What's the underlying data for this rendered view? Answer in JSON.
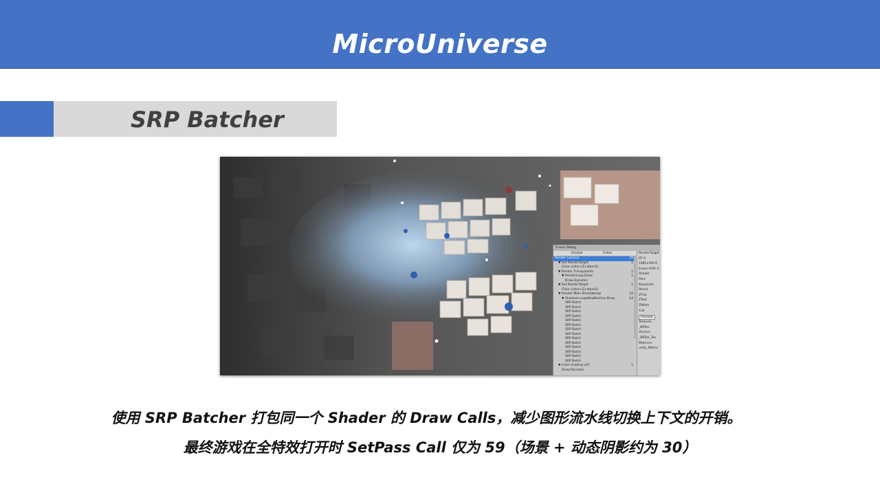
{
  "header": {
    "title": "MicroUniverse"
  },
  "section": {
    "title": "SRP Batcher"
  },
  "frame_debugger": {
    "window_title": "Frame Debug",
    "toggle_label": "Disable",
    "target_label": "Editor",
    "tree": [
      {
        "label": "Render Camera",
        "count": "59",
        "indent": 0,
        "selected": true
      },
      {
        "label": "▼ Set RenderTarget",
        "count": "1",
        "indent": 1
      },
      {
        "label": "Clear (color+Z+stencil)",
        "count": "",
        "indent": 2
      },
      {
        "label": "▼ Render Transparents",
        "count": "1",
        "indent": 1
      },
      {
        "label": "▼ RenderLoop.Draw",
        "count": "1",
        "indent": 2
      },
      {
        "label": "Draw Dynamic",
        "count": "",
        "indent": 3
      },
      {
        "label": "▼ Set RenderTarget",
        "count": "1",
        "indent": 1
      },
      {
        "label": "Clear (color+Z+stencil)",
        "count": "",
        "indent": 2
      },
      {
        "label": "▼ Render Main Shadowmap",
        "count": "14",
        "indent": 1
      },
      {
        "label": "▼ Shadows.LoopNewBatcher.Draw",
        "count": "14",
        "indent": 2
      },
      {
        "label": "SRP Batch",
        "count": "",
        "indent": 3
      },
      {
        "label": "SRP Batch",
        "count": "",
        "indent": 3
      },
      {
        "label": "SRP Batch",
        "count": "",
        "indent": 3
      },
      {
        "label": "SRP Batch",
        "count": "",
        "indent": 3
      },
      {
        "label": "SRP Batch",
        "count": "",
        "indent": 3
      },
      {
        "label": "SRP Batch",
        "count": "",
        "indent": 3
      },
      {
        "label": "SRP Batch",
        "count": "",
        "indent": 3
      },
      {
        "label": "SRP Batch",
        "count": "",
        "indent": 3
      },
      {
        "label": "SRP Batch",
        "count": "",
        "indent": 3
      },
      {
        "label": "SRP Batch",
        "count": "",
        "indent": 3
      },
      {
        "label": "SRP Batch",
        "count": "",
        "indent": 3
      },
      {
        "label": "SRP Batch",
        "count": "",
        "indent": 3
      },
      {
        "label": "SRP Batch",
        "count": "",
        "indent": 3
      },
      {
        "label": "SRP Batch",
        "count": "",
        "indent": 3
      },
      {
        "label": "▼ Color Grading LUT",
        "count": "1",
        "indent": 1
      },
      {
        "label": "Draw Dynamic",
        "count": "",
        "indent": 2
      }
    ],
    "details": [
      "RenderTarget",
      "RT 0",
      "1081x780 R",
      "Event #59: S",
      "Shader",
      "Pass",
      "Keywords",
      "Blend",
      "ZClip",
      "ZTest",
      "ZWrite",
      "Cull"
    ],
    "preview_label": "Preview",
    "details_lower": [
      "Textures",
      "_BRTex",
      "Vectors",
      "_BRTex_Tex",
      "Matrices",
      "unity_Matrix"
    ]
  },
  "description": {
    "line1": "使用 SRP Batcher 打包同一个 Shader 的 Draw Calls，减少图形流水线切换上下文的开销。",
    "line2": "最终游戏在全特效打开时 SetPass Call 仅为 59（场景 + 动态阴影约为 30）"
  }
}
